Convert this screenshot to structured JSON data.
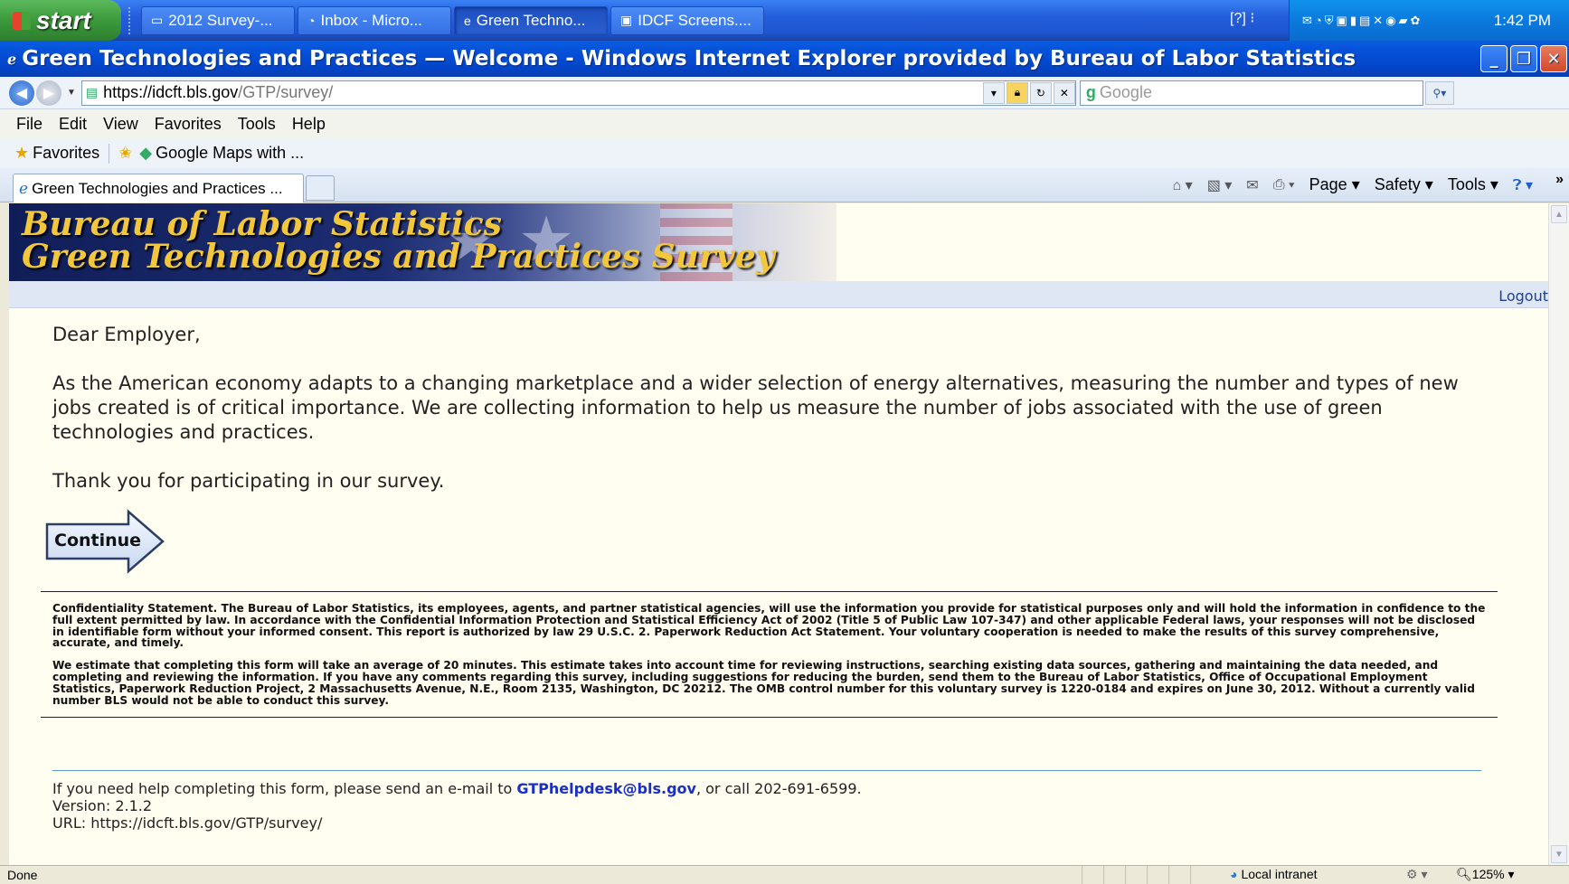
{
  "taskbar": {
    "start_label": "start",
    "tasks": [
      {
        "label": "2012 Survey-...",
        "icon": "folder-icon"
      },
      {
        "label": "Inbox - Micro...",
        "icon": "outlook-icon"
      },
      {
        "label": "Green Techno...",
        "icon": "ie-icon"
      },
      {
        "label": "IDCF Screens....",
        "icon": "word-icon"
      }
    ],
    "clock": "1:42 PM"
  },
  "window": {
    "title": "Green Technologies and Practices — Welcome - Windows Internet Explorer provided by Bureau of Labor Statistics"
  },
  "address": {
    "scheme": "https://",
    "host": "idcft.bls.gov",
    "path": "/GTP/survey/",
    "search_placeholder": "Google"
  },
  "menu": [
    "File",
    "Edit",
    "View",
    "Favorites",
    "Tools",
    "Help"
  ],
  "favorites": {
    "label": "Favorites",
    "items": [
      "Google Maps with ..."
    ]
  },
  "tab": {
    "label": "Green Technologies and Practices ..."
  },
  "commandbar": {
    "page": "Page",
    "safety": "Safety",
    "tools": "Tools"
  },
  "banner": {
    "line1": "Bureau of Labor Statistics",
    "line2": "Green Technologies and Practices Survey"
  },
  "logout": "Logout",
  "letter": {
    "greeting": "Dear Employer,",
    "body": "As the American economy adapts to a changing marketplace and a wider selection of energy alternatives, measuring the number and types of new jobs created is of critical importance. We are collecting information to help us measure the number of jobs associated with the use of green technologies and practices.",
    "thanks": "Thank you for participating in our survey."
  },
  "continue_label": "Continue",
  "legal": {
    "confidentiality": "Confidentiality Statement. The Bureau of Labor Statistics, its employees, agents, and partner statistical agencies, will use the information you provide for statistical purposes only and will hold the information in confidence to the full extent permitted by law. In accordance with the Confidential Information Protection and Statistical Efficiency Act of 2002 (Title 5 of Public Law 107-347) and other applicable Federal laws, your responses will not be disclosed in identifiable form without your informed consent. This report is authorized by law 29 U.S.C. 2. Paperwork Reduction Act Statement. Your voluntary cooperation is needed to make the results of this survey comprehensive, accurate, and timely.",
    "burden": "We estimate that completing this form will take an average of 20 minutes. This estimate takes into account time for reviewing instructions, searching existing data sources, gathering and maintaining the data needed, and completing and reviewing the information. If you have any comments regarding this survey, including suggestions for reducing the burden, send them to the Bureau of Labor Statistics, Office of Occupational Employment Statistics, Paperwork Reduction Project, 2 Massachusetts Avenue, N.E., Room 2135, Washington, DC 20212. The OMB control number for this voluntary survey is 1220-0184 and expires on June 30, 2012. Without a currently valid number BLS would not be able to conduct this survey."
  },
  "help": {
    "prefix": "If you need help completing this form, please send an e-mail to ",
    "email": "GTPhelpdesk@bls.gov",
    "suffix": ", or call 202-691-6599.",
    "version": "Version: 2.1.2",
    "url": "URL: https://idcft.bls.gov/GTP/survey/"
  },
  "status": {
    "text": "Done",
    "zone": "Local intranet",
    "zoom": "125%"
  }
}
